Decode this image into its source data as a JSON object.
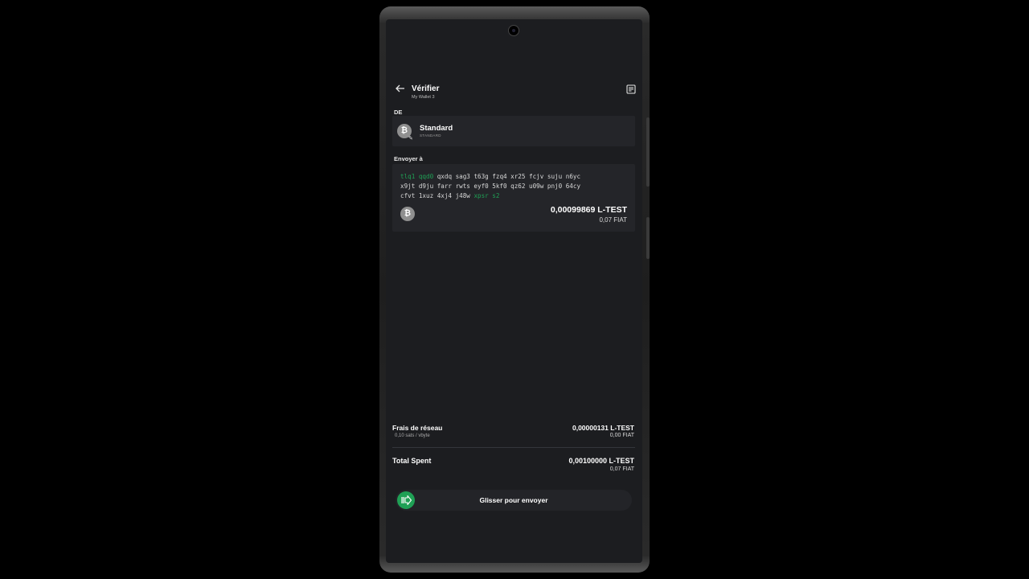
{
  "header": {
    "title": "Vérifier",
    "subtitle": "My Wallet 3"
  },
  "from": {
    "label": "DE",
    "account_name": "Standard",
    "account_type": "STANDARD"
  },
  "to": {
    "label": "Envoyer à",
    "address_lines": [
      {
        "hl": "tlq1 qqd0",
        "rest": " qxdq sag3 t63g fzq4 xr25 fcjv suju n6yc",
        "tail": ""
      },
      {
        "hl": "",
        "rest": "x9jt d9ju farr rwts eyf0 5kf0 qz62 u09w pnj0 64cy",
        "tail": ""
      },
      {
        "hl": "",
        "rest": "cfvt 1xuz 4xj4 j48w ",
        "tail": "xpsr s2"
      }
    ],
    "amount": "0,00099869 L-TEST",
    "fiat": "0,07 FIAT"
  },
  "fee": {
    "label": "Frais de réseau",
    "rate": "0,10 sats / vbyte",
    "amount": "0,00000131 L-TEST",
    "fiat": "0,00 FIAT"
  },
  "total": {
    "label": "Total Spent",
    "amount": "0,00100000 L-TEST",
    "fiat": "0,07 FIAT"
  },
  "slider": {
    "label": "Glisser pour envoyer"
  },
  "colors": {
    "accent": "#1fa055",
    "background": "#1c1d20",
    "card": "#242529"
  }
}
